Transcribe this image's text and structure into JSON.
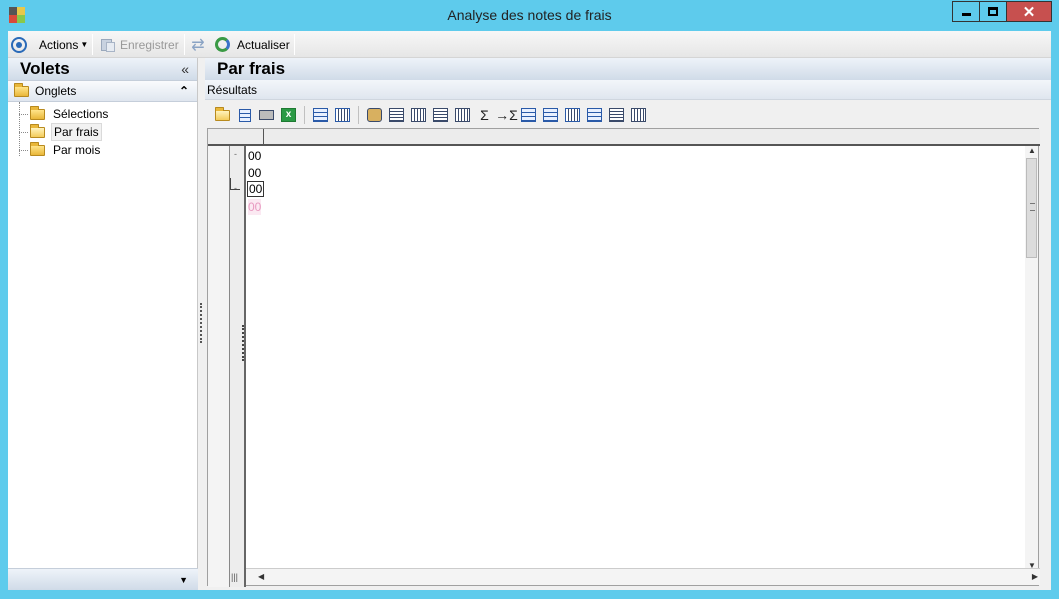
{
  "window": {
    "title": "Analyse des notes de frais"
  },
  "toolbar": {
    "actions_label": "Actions",
    "save_label": "Enregistrer",
    "refresh_label": "Actualiser"
  },
  "left_pane": {
    "title": "Volets",
    "collapse_glyph": "«",
    "section_title": "Onglets",
    "section_glyph": "⌃",
    "items": [
      {
        "label": "Sélections",
        "selected": false
      },
      {
        "label": "Par frais",
        "selected": true
      },
      {
        "label": "Par mois",
        "selected": false
      }
    ],
    "footer_glyph": "▼"
  },
  "right_pane": {
    "title": "Par frais",
    "results_label": "Résultats",
    "rows": [
      {
        "value": "00",
        "state": "normal",
        "expander": "-"
      },
      {
        "value": "00",
        "state": "normal",
        "expander": ""
      },
      {
        "value": "00",
        "state": "focused",
        "expander": "-"
      },
      {
        "value": "00",
        "state": "highlight",
        "expander": ""
      }
    ]
  },
  "colors": {
    "window_frame": "#5ecbec",
    "close_button": "#c7504f",
    "pink_row": "#e89ac0"
  }
}
